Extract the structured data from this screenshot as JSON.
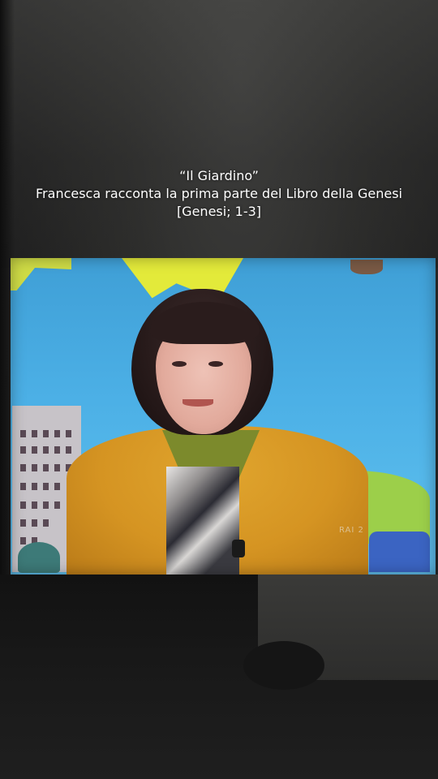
{
  "caption": {
    "line1": "“Il Giardino”",
    "line2": "Francesca racconta la prima parte del Libro della Genesi",
    "line3": "[Genesi; 1-3]"
  },
  "tv": {
    "channel_logo_text": "RAI 2"
  },
  "colors": {
    "sky": "#4cb0e6",
    "jacket": "#d59422",
    "hair": "#231717",
    "background": "#1c1c1c"
  }
}
